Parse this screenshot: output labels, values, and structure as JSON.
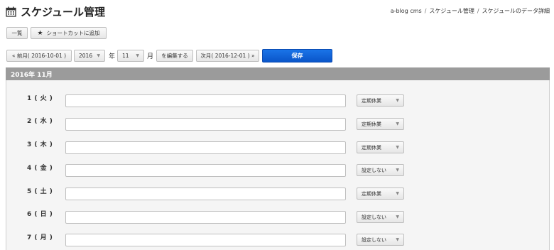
{
  "page": {
    "title": "スケジュール管理",
    "breadcrumb": [
      "a-blog cms",
      "スケジュール管理",
      "スケジュールのデータ詳細"
    ],
    "breadcrumb_sep": "/"
  },
  "toolbar": {
    "list_label": "一覧",
    "shortcut_label": "ショートカットに追加"
  },
  "nav": {
    "prev_label": "« 前月( 2016-10-01 )",
    "year_value": "2016",
    "year_unit": "年",
    "month_value": "11",
    "month_unit": "月",
    "edit_label": "を編集する",
    "next_label": "次月( 2016-12-01 ) »",
    "save_label": "保存"
  },
  "panel": {
    "heading": "2016年 11月",
    "days": [
      {
        "label": "1 ( 火 )",
        "value": "",
        "status": "定期休業"
      },
      {
        "label": "2 ( 水 )",
        "value": "",
        "status": "定期休業"
      },
      {
        "label": "3 ( 木 )",
        "value": "",
        "status": "定期休業"
      },
      {
        "label": "4 ( 金 )",
        "value": "",
        "status": "設定しない"
      },
      {
        "label": "5 ( 土 )",
        "value": "",
        "status": "定期休業"
      },
      {
        "label": "6 ( 日 )",
        "value": "",
        "status": "設定しない"
      },
      {
        "label": "7 ( 月 )",
        "value": "",
        "status": "設定しない"
      }
    ]
  },
  "icons": {
    "calendar": "calendar-icon",
    "star": "star-icon",
    "caret": "chevron-down-icon"
  }
}
